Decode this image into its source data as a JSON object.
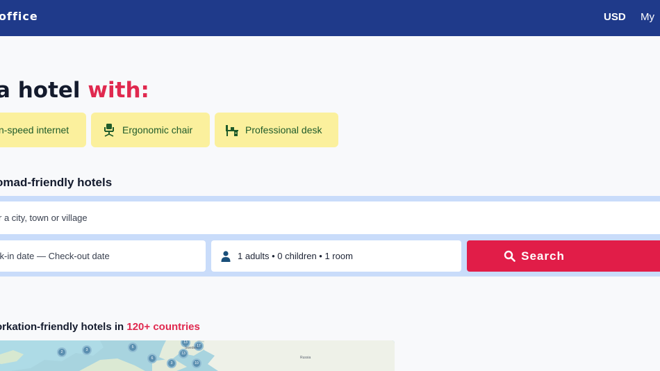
{
  "header": {
    "brand": "office",
    "currency": "USD",
    "my_link": "My"
  },
  "hero": {
    "headline_prefix": "a hotel",
    "headline_accent": "with:"
  },
  "amenities": [
    {
      "label": "n-speed internet",
      "icon": "wifi-icon"
    },
    {
      "label": "Ergonomic chair",
      "icon": "chair-icon"
    },
    {
      "label": "Professional desk",
      "icon": "desk-icon"
    }
  ],
  "search": {
    "title": "omad-friendly hotels",
    "city_placeholder": "r a city, town or village",
    "dates_placeholder": "ck-in date — Check-out date",
    "guests": "1 adults • 0 children • 1 room",
    "button_label": "Search"
  },
  "countries": {
    "title_prefix": "orkation-friendly hotels in",
    "title_accent": "120+ countries"
  },
  "map": {
    "clusters": [
      "2",
      "3",
      "5",
      "6",
      "3",
      "13",
      "17",
      "10",
      "13"
    ],
    "labels": [
      "Sweden",
      "Russia"
    ]
  },
  "colors": {
    "topbar": "#1f3a8a",
    "accent": "#e0294f",
    "chip_bg": "#fbf09d",
    "chip_text": "#1f5b2a",
    "search_panel": "#c9dcfa",
    "search_button": "#e11d48"
  }
}
